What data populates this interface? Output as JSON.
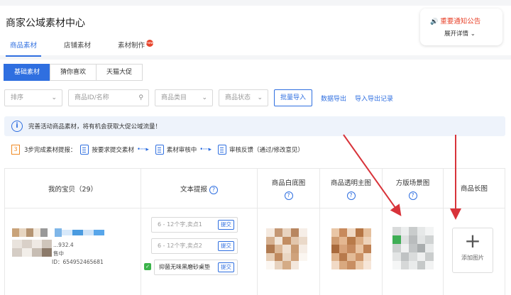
{
  "header": {
    "title": "商家公域素材中心"
  },
  "tabs": [
    {
      "label": "商品素材"
    },
    {
      "label": "店铺素材"
    },
    {
      "label": "素材制作",
      "badge": "new"
    }
  ],
  "notice": {
    "title": "重要通知公告",
    "expand": "展开详情"
  },
  "segments": [
    "基础素材",
    "猜你喜欢",
    "天猫大促"
  ],
  "filters": {
    "sort": "排序",
    "search_placeholder": "商品ID/名称",
    "category": "商品类目",
    "status": "商品状态",
    "bulk_import": "批量导入",
    "export": "数据导出",
    "import_export_log": "导入导出记录"
  },
  "info_banner": "完善活动商品素材，将有机会获取大促公域流量！",
  "steps": {
    "lead": "3步完成素材提报：",
    "num": "3",
    "s1": "按要求提交素材",
    "s2": "素材审核中",
    "s3": "审核反馈（通过/修改意见）"
  },
  "table": {
    "headers": [
      "我的宝贝（29）",
      "文本提报",
      "商品白底图",
      "商品透明主图",
      "方版场景图",
      "商品长图"
    ],
    "row": {
      "price": "...932.4",
      "status": "售中",
      "id": "ID：654952465681",
      "selling_points": [
        {
          "placeholder": "6 - 12个字,卖点1",
          "value": ""
        },
        {
          "placeholder": "6 - 12个字,卖点2",
          "value": ""
        },
        {
          "placeholder": "",
          "value": "抑菌无味黑磨砂桌垫"
        }
      ],
      "submit_label": "提交",
      "add_image_label": "添加图片"
    }
  },
  "colors": {
    "accent": "#2f6fe0",
    "alert": "#e8442c",
    "arrow": "#d8333a"
  }
}
